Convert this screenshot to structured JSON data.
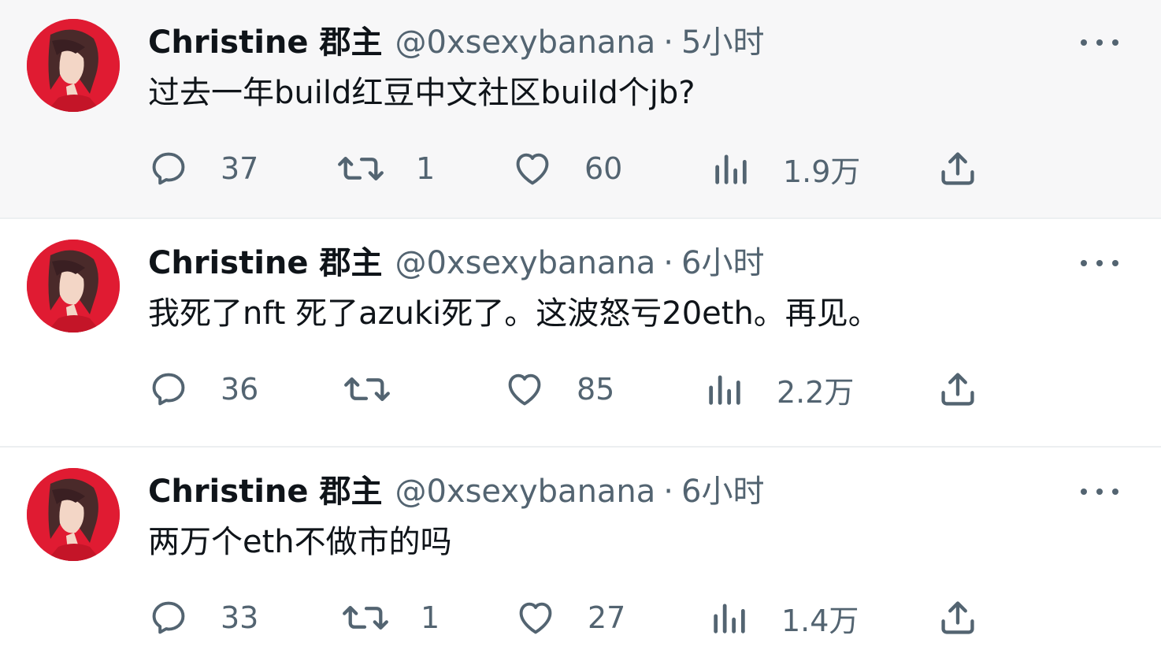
{
  "tweets": [
    {
      "name": "Christine 郡主",
      "handle": "@0xsexybanana",
      "separator": "·",
      "time": "5小时",
      "text": "过去一年build红豆中文社区build个jb?",
      "replies": "37",
      "retweets": "1",
      "likes": "60",
      "views": "1.9万"
    },
    {
      "name": "Christine 郡主",
      "handle": "@0xsexybanana",
      "separator": "·",
      "time": "6小时",
      "text": "我死了nft 死了azuki死了。这波怒亏20eth。再见。",
      "replies": "36",
      "retweets": "",
      "likes": "85",
      "views": "2.2万"
    },
    {
      "name": "Christine 郡主",
      "handle": "@0xsexybanana",
      "separator": "·",
      "time": "6小时",
      "text": "两万个eth不做市的吗",
      "replies": "33",
      "retweets": "1",
      "likes": "27",
      "views": "1.4万"
    }
  ],
  "icons": {
    "reply": "reply-icon",
    "retweet": "retweet-icon",
    "like": "heart-icon",
    "views": "views-icon",
    "share": "share-icon",
    "more": "more-icon"
  },
  "colors": {
    "text_primary": "#0f1419",
    "text_secondary": "#536471",
    "avatar_bg": "#e01b32",
    "highlight_row_bg": "#f7f7f8"
  }
}
